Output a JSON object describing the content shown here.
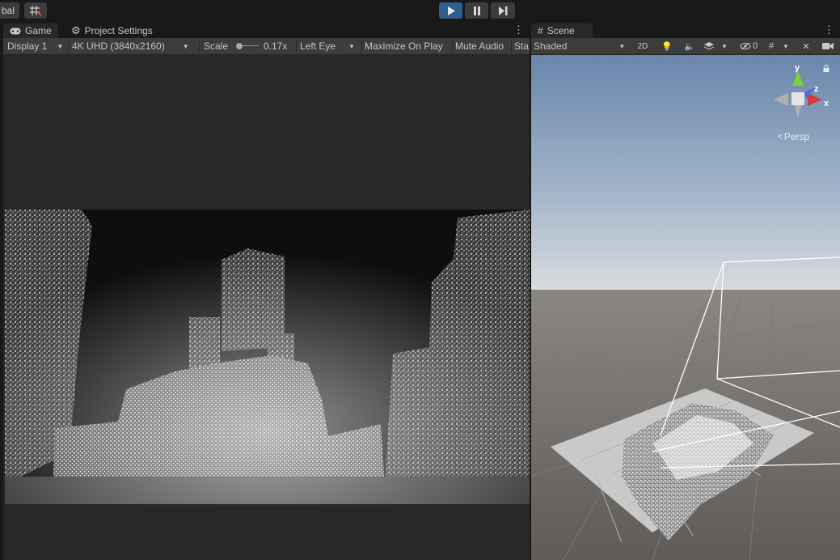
{
  "toolbar": {
    "left_fragment": "bal",
    "play_icon": "play-icon",
    "pause_icon": "pause-icon",
    "step_icon": "step-icon"
  },
  "game": {
    "tab_label": "Game",
    "settings_tab_label": "Project Settings",
    "display": "Display 1",
    "resolution": "4K UHD (3840x2160)",
    "scale_label": "Scale",
    "scale_value": "0.17x",
    "eye": "Left Eye",
    "maximize": "Maximize On Play",
    "mute": "Mute Audio",
    "stats": "Sta"
  },
  "scene": {
    "tab_label": "Scene",
    "draw_mode": "Shaded",
    "btn_2d": "2D",
    "hidden_count": "0",
    "gizmo_y": "y",
    "gizmo_z": "z",
    "gizmo_x": "x",
    "persp_label": "Persp"
  },
  "colors": {
    "play_active": "#2f5f8f",
    "panel_bg": "#282828",
    "toolbar_bg": "#3c3c3c",
    "sky_top": "#6a86ac",
    "ground": "#6e6a67"
  }
}
